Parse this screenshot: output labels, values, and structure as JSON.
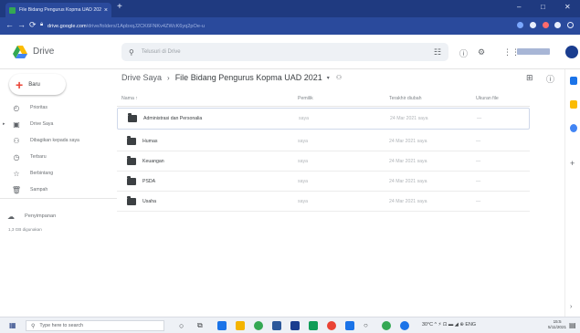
{
  "browser": {
    "tab_title": "File Bidang Pengurus Kopma UAD 2021 - Google Drive",
    "tab_close": "×",
    "new_tab": "+",
    "url_host": "drive.google.com",
    "url_rest": "/drive/folders/1ApbxqJ2CK6FNKv4ZWcK6yq2pOe-u",
    "window_controls": [
      "–",
      "□",
      "✕"
    ]
  },
  "header": {
    "app_name": "Drive",
    "search_placeholder": "Telusuri di Drive",
    "icons": [
      "tune-icon",
      "help-icon",
      "settings-icon",
      "apps-icon"
    ],
    "accent": "#1a73e8"
  },
  "sidebar": {
    "new_label": "Baru",
    "items": [
      {
        "label": "Prioritas",
        "icon": "priority-icon"
      },
      {
        "label": "Drive Saya",
        "icon": "my-drive-icon"
      },
      {
        "label": "Dibagikan kepada saya",
        "icon": "shared-icon"
      },
      {
        "label": "Terbaru",
        "icon": "recent-icon"
      },
      {
        "label": "Berbintang",
        "icon": "star-icon"
      },
      {
        "label": "Sampah",
        "icon": "trash-icon"
      }
    ],
    "storage_label": "Penyimpanan",
    "storage_sub": "1,3 GB digunakan"
  },
  "main": {
    "breadcrumb_root": "Drive Saya",
    "breadcrumb_current": "File Bidang Pengurus Kopma UAD 2021",
    "columns": {
      "name": "Nama",
      "owner": "Pemilik",
      "modified": "Terakhir diubah",
      "size": "Ukuran file"
    },
    "rows": [
      {
        "name": "Administrasi dan Personalia",
        "owner": "saya",
        "modified": "24 Mar 2021 saya",
        "size": "—"
      },
      {
        "name": "Humas",
        "owner": "saya",
        "modified": "24 Mar 2021 saya",
        "size": "—"
      },
      {
        "name": "Keuangan",
        "owner": "saya",
        "modified": "24 Mar 2021 saya",
        "size": "—"
      },
      {
        "name": "PSDA",
        "owner": "saya",
        "modified": "24 Mar 2021 saya",
        "size": "—"
      },
      {
        "name": "Usaha",
        "owner": "saya",
        "modified": "24 Mar 2021 saya",
        "size": "—"
      }
    ]
  },
  "taskbar": {
    "search_placeholder": "Type here to search",
    "tray_text": "30°C ^ ⚡ ⊡ ▬ ◢ ⊕ ENG",
    "time": "15:5",
    "date": "5/11/2021"
  }
}
